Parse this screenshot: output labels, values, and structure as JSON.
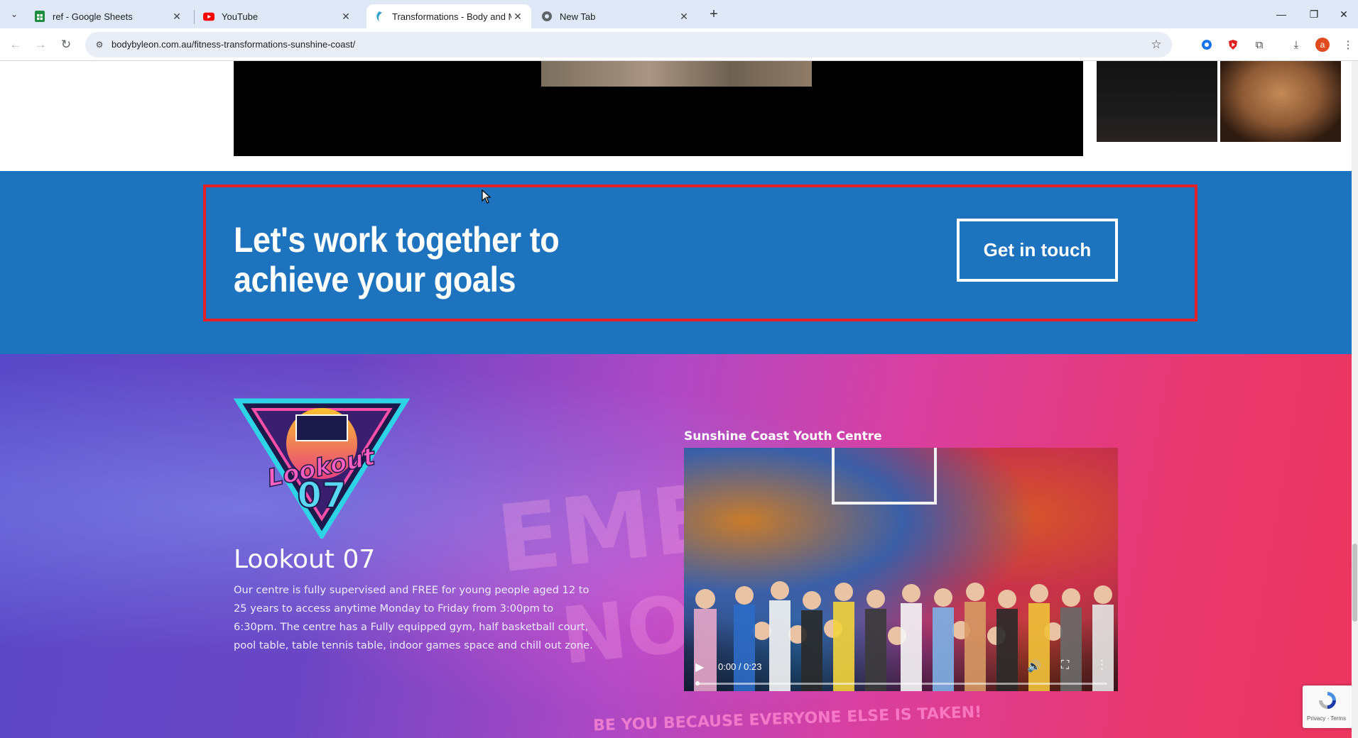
{
  "browser": {
    "tabs": [
      {
        "title": "ref - Google Sheets",
        "icon": "google-sheets-icon",
        "active": false
      },
      {
        "title": "YouTube",
        "icon": "youtube-icon",
        "active": false
      },
      {
        "title": "Transformations - Body and Mind",
        "icon": "bodybyleon-icon",
        "active": true
      },
      {
        "title": "New Tab",
        "icon": "chrome-icon",
        "active": false
      }
    ],
    "url": "bodybyleon.com.au/fitness-transformations-sunshine-coast/",
    "profile_initial": "a"
  },
  "cta": {
    "heading_line1": "Let's work together to",
    "heading_line2": "achieve your goals",
    "button_label": "Get in touch",
    "background_color": "#1e73be",
    "highlight_color": "#e32227"
  },
  "youth_centre": {
    "logo_text_top": "Lookout",
    "logo_text_bottom": "07",
    "title": "Lookout 07",
    "description": "Our centre is fully supervised and FREE for young people aged 12 to 25 years to access anytime Monday to Friday from 3:00pm to 6:30pm. The centre has a Fully equipped gym, half basketball court, pool table, table tennis table, indoor games space and chill out zone.",
    "video_heading": "Sunshine Coast Youth Centre",
    "video_time": "0:00 / 0:23",
    "video_progress": 0,
    "wall_tagline": "BE YOU BECAUSE EVERYONE ELSE IS TAKEN!"
  },
  "recaptcha": {
    "links": "Privacy - Terms"
  }
}
